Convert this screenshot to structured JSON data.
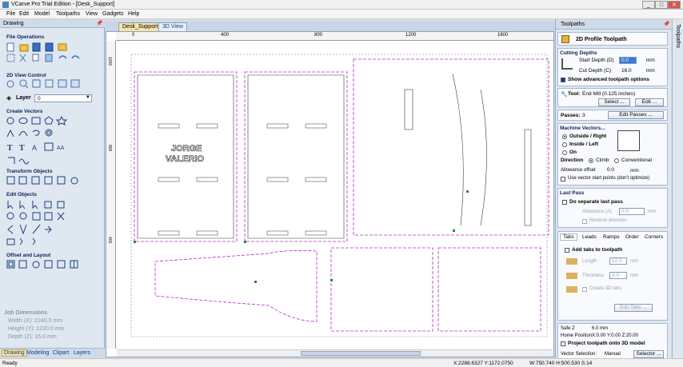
{
  "window": {
    "title": "VCarve Pro Trial Edition - [Desk_Support]",
    "min": "_",
    "max": "□",
    "close": "✕"
  },
  "menu": [
    "File",
    "Edit",
    "Model",
    "Toolpaths",
    "View",
    "Gadgets",
    "Help"
  ],
  "left_panel": {
    "title": "Drawing",
    "sections": {
      "file_ops": "File Operations",
      "view_control": "2D View Control",
      "create_vectors": "Create Vectors",
      "transform": "Transform Objects",
      "edit_objects": "Edit Objects",
      "offset_layout": "Offset and Layout"
    },
    "layer_label": "Layer",
    "layer_value": "0",
    "job_dims": {
      "title": "Job Dimensions",
      "width": "Width  (X): 2240.0 mm",
      "height": "Height (Y): 1220.0 mm",
      "depth": "Depth  (Z): 15.0 mm"
    },
    "tabs": [
      "Drawing",
      "Modeling",
      "Clipart",
      "Layers"
    ]
  },
  "doc_tabs": [
    "Desk_Support",
    "3D View"
  ],
  "ruler": {
    "top": [
      "0",
      "400",
      "800",
      "1200",
      "1600"
    ],
    "left": [
      "1200",
      "800",
      "400"
    ]
  },
  "canvas_text": {
    "line1": "JORGE",
    "line2": "VALERIO"
  },
  "right_panel": {
    "title": "Toolpaths",
    "header": "2D Profile Toolpath",
    "cutting_depths": "Cutting Depths",
    "start_depth_label": "Start Depth (D)",
    "start_depth_value": "0.0",
    "cut_depth_label": "Cut Depth (C)",
    "cut_depth_value": "16.0",
    "unit": "mm",
    "show_advanced": "Show advanced toolpath options",
    "tool_label": "Tool:",
    "tool_value": "End Mill (0.125 inches)",
    "select_btn": "Select ...",
    "edit_btn": "Edit ...",
    "passes_label": "Passes:",
    "passes_value": "3",
    "edit_passes_btn": "Edit Passes ...",
    "machine_vectors": "Machine Vectors...",
    "mv_options": [
      "Outside / Right",
      "Inside / Left",
      "On"
    ],
    "direction_label": "Direction",
    "dir_climb": "Climb",
    "dir_conv": "Conventional",
    "allowance_label": "Allowance offset",
    "allowance_value": "0.0",
    "use_start_points": "Use vector start points (don't optimize)",
    "last_pass": "Last Pass",
    "do_separate": "Do separate last pass",
    "allowance_a": "Allowance (A)",
    "allowance_a_value": "0.0",
    "reverse_dir": "Reverse direction",
    "tabs": [
      "Tabs",
      "Leads",
      "Ramps",
      "Order",
      "Corners"
    ],
    "add_tabs": "Add tabs to toolpath",
    "length_label": "Length",
    "length_value": "12.0",
    "thickness_label": "Thickness",
    "thickness_value": "3.0",
    "create_3d_tabs": "Create 3D tabs",
    "edit_tabs_btn": "Edit Tabs ...",
    "safe_z_label": "Safe Z",
    "safe_z_value": "6.0 mm",
    "home_label": "Home Position",
    "home_value": "X:0.00 Y:0.00 Z:20.00",
    "project_toolpath": "Project toolpath onto 3D model",
    "vector_sel_label": "Vector Selection:",
    "vector_sel_value": "Manual",
    "selector_btn": "Selector ..."
  },
  "side_strip": "Toolpaths",
  "status": {
    "left": "Ready",
    "coords": "X:2288.6327 Y:1172.0750",
    "size": "W:750.740  H:500.530  S:14"
  }
}
